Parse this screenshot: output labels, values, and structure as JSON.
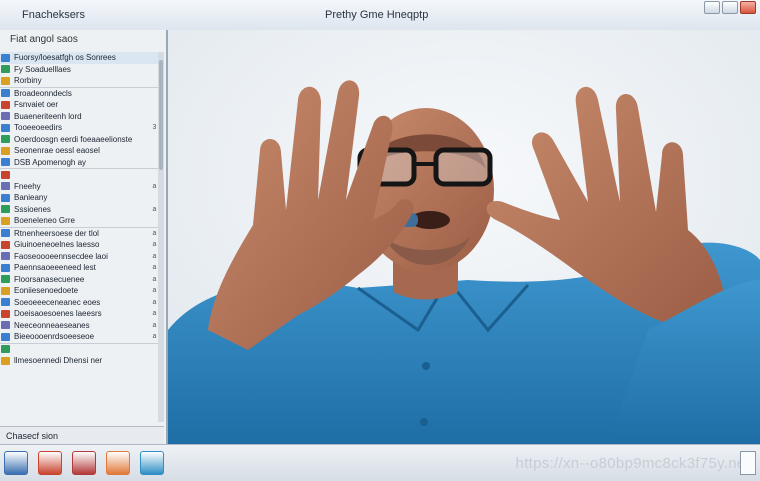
{
  "window": {
    "app_title": "Fnacheksers",
    "title": "Prethy Gme Hneqptp"
  },
  "sidebar": {
    "header": "Fiat angol saos",
    "items": [
      {
        "label": "Fuorsy/loesatfgh os Sonrees",
        "color": "#3b7fd0",
        "marker": ""
      },
      {
        "label": "Fy Soaduelllaes",
        "color": "#2f9d5a",
        "marker": ""
      },
      {
        "label": "Rorbiny",
        "color": "#d9a021",
        "marker": ""
      },
      {
        "label": "Broadeonndecls",
        "color": "#3b7fd0",
        "marker": ""
      },
      {
        "label": "Fsnvaiet oer",
        "color": "#c9442f",
        "marker": ""
      },
      {
        "label": "Buaeneriteenh lord",
        "color": "#6a6fb5",
        "marker": ""
      },
      {
        "label": "Tooeeoeedirs",
        "color": "#3b7fd0",
        "marker": "3"
      },
      {
        "label": "Ooerdoosgn eerdi foeaaeelionste",
        "color": "#2f9d5a",
        "marker": ""
      },
      {
        "label": "Seonenrae oessl eaosel",
        "color": "#d9a021",
        "marker": ""
      },
      {
        "label": "DSB Apomenogh ay",
        "color": "#3b7fd0",
        "marker": ""
      },
      {
        "label": "",
        "color": "#c9442f",
        "marker": ""
      },
      {
        "label": "Fneehy",
        "color": "#6a6fb5",
        "marker": "a"
      },
      {
        "label": "Banieany",
        "color": "#3b7fd0",
        "marker": ""
      },
      {
        "label": "Sssioenes",
        "color": "#2f9d5a",
        "marker": "a"
      },
      {
        "label": "Boeneleneo Grre",
        "color": "#d9a021",
        "marker": ""
      },
      {
        "label": "Rtnenheersoese der tlol",
        "color": "#3b7fd0",
        "marker": "a"
      },
      {
        "label": "Giuinoeneoelnes laesso",
        "color": "#c9442f",
        "marker": "a"
      },
      {
        "label": "Faoseoooeennsecdee laoi",
        "color": "#6a6fb5",
        "marker": "a"
      },
      {
        "label": "Paennsaoeeeneed lest",
        "color": "#3b7fd0",
        "marker": "a"
      },
      {
        "label": "Floorsanasecuenee",
        "color": "#2f9d5a",
        "marker": "a"
      },
      {
        "label": "Eoniiesenoedoete",
        "color": "#d9a021",
        "marker": "a"
      },
      {
        "label": "Soeoeeeceneanec eoes",
        "color": "#3b7fd0",
        "marker": "a"
      },
      {
        "label": "Doeisaoesoenes laeesrs",
        "color": "#c9442f",
        "marker": "a"
      },
      {
        "label": "Neeceonneaeseanes",
        "color": "#6a6fb5",
        "marker": "a"
      },
      {
        "label": "Bieeoooenrdsoeeseoe",
        "color": "#3b7fd0",
        "marker": "a"
      },
      {
        "label": "",
        "color": "#2f9d5a",
        "marker": ""
      },
      {
        "label": "llmesoennedi Dhensi ner",
        "color": "#d9a021",
        "marker": ""
      }
    ],
    "footer": "Chasecf sion"
  },
  "taskbar": {
    "watermark": "https://xn--o80bp9mc8ck3f75y.net",
    "icons": [
      {
        "name": "start",
        "color": "#3b6fb0"
      },
      {
        "name": "browser",
        "color": "#c9442f"
      },
      {
        "name": "media",
        "color": "#b23a3a"
      },
      {
        "name": "download",
        "color": "#e0793a"
      },
      {
        "name": "bird",
        "color": "#2f8fc4"
      }
    ]
  }
}
